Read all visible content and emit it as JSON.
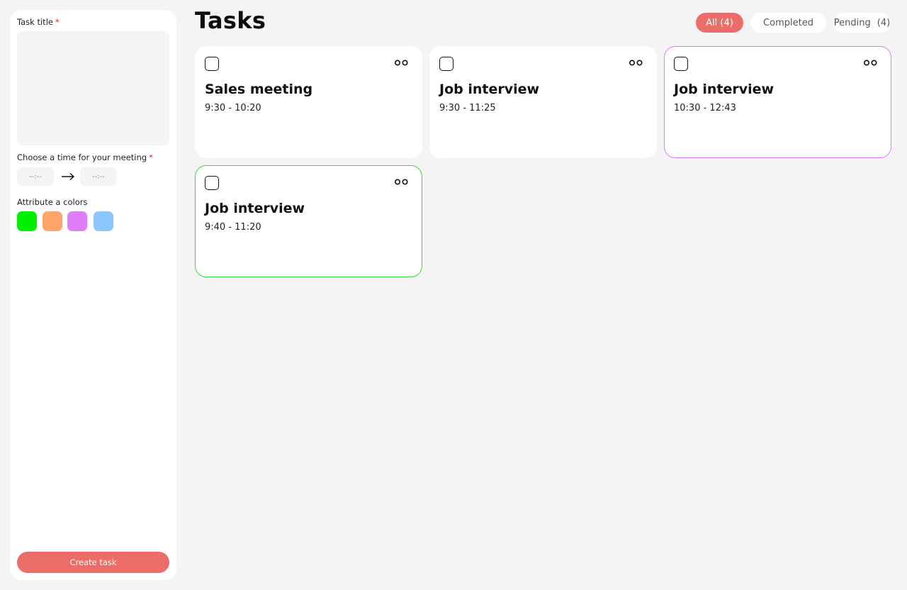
{
  "sidebar": {
    "task_title_label": "Task title",
    "required_mark": "*",
    "time_label": "Choose a time for your meeting",
    "time_start_placeholder": "--:--",
    "time_end_placeholder": "--:--",
    "colors_label": "Attribute a colors",
    "colors": [
      "#00f000",
      "#ffa46b",
      "#e07df8",
      "#8ec7ff"
    ],
    "create_button": "Create task"
  },
  "header": {
    "title": "Tasks",
    "filters": {
      "all": "All (4)",
      "completed": "Completed",
      "pending_label": "Pending",
      "pending_count": "(4)"
    },
    "accent_color": "#ec6d68"
  },
  "tasks": [
    {
      "title": "Sales meeting",
      "time": "9:30 - 10:20",
      "color": "none"
    },
    {
      "title": "Job interview",
      "time": "9:30 - 11:25",
      "color": "none"
    },
    {
      "title": "Job interview",
      "time": "10:30 - 12:43",
      "color": "#e07df8"
    },
    {
      "title": "Job interview",
      "time": "9:40 - 11:20",
      "color": "#3ad83a"
    }
  ]
}
